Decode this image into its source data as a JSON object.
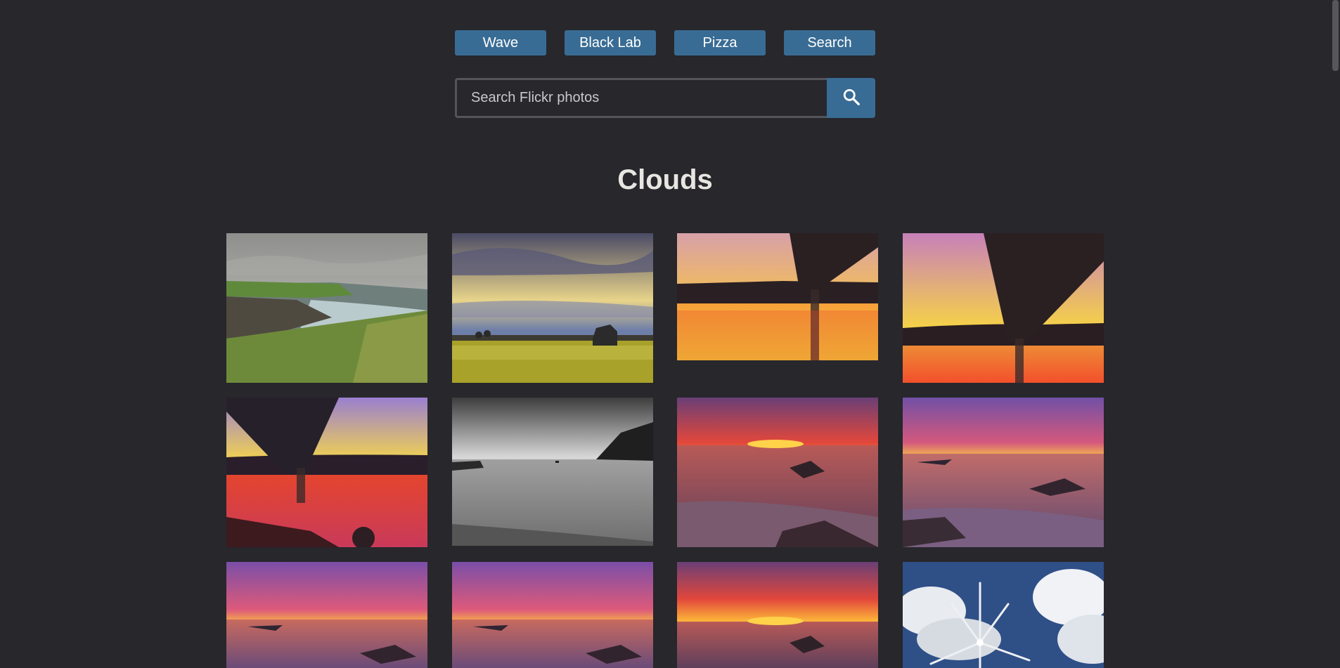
{
  "nav": {
    "buttons": [
      {
        "label": "Wave"
      },
      {
        "label": "Black Lab"
      },
      {
        "label": "Pizza"
      },
      {
        "label": "Search"
      }
    ]
  },
  "search": {
    "placeholder": "Search Flickr photos"
  },
  "gallery": {
    "title": "Clouds",
    "photos": [
      {
        "subject": "green coastal cliff under cloudy sky"
      },
      {
        "subject": "barn in field under dramatic clouds"
      },
      {
        "subject": "bridge underside at sunset over water"
      },
      {
        "subject": "bridge underside at sunset over water"
      },
      {
        "subject": "bridge underside at sunset with driftwood"
      },
      {
        "subject": "black and white bay with sailboat"
      },
      {
        "subject": "fiery sunset over rocky beach"
      },
      {
        "subject": "purple sunset over rocky shore"
      },
      {
        "subject": "purple sunset over rocky shore"
      },
      {
        "subject": "purple sunset over rocky shore"
      },
      {
        "subject": "fiery sunset over rocky beach"
      },
      {
        "subject": "wind turbine against blue sky and clouds"
      }
    ]
  }
}
